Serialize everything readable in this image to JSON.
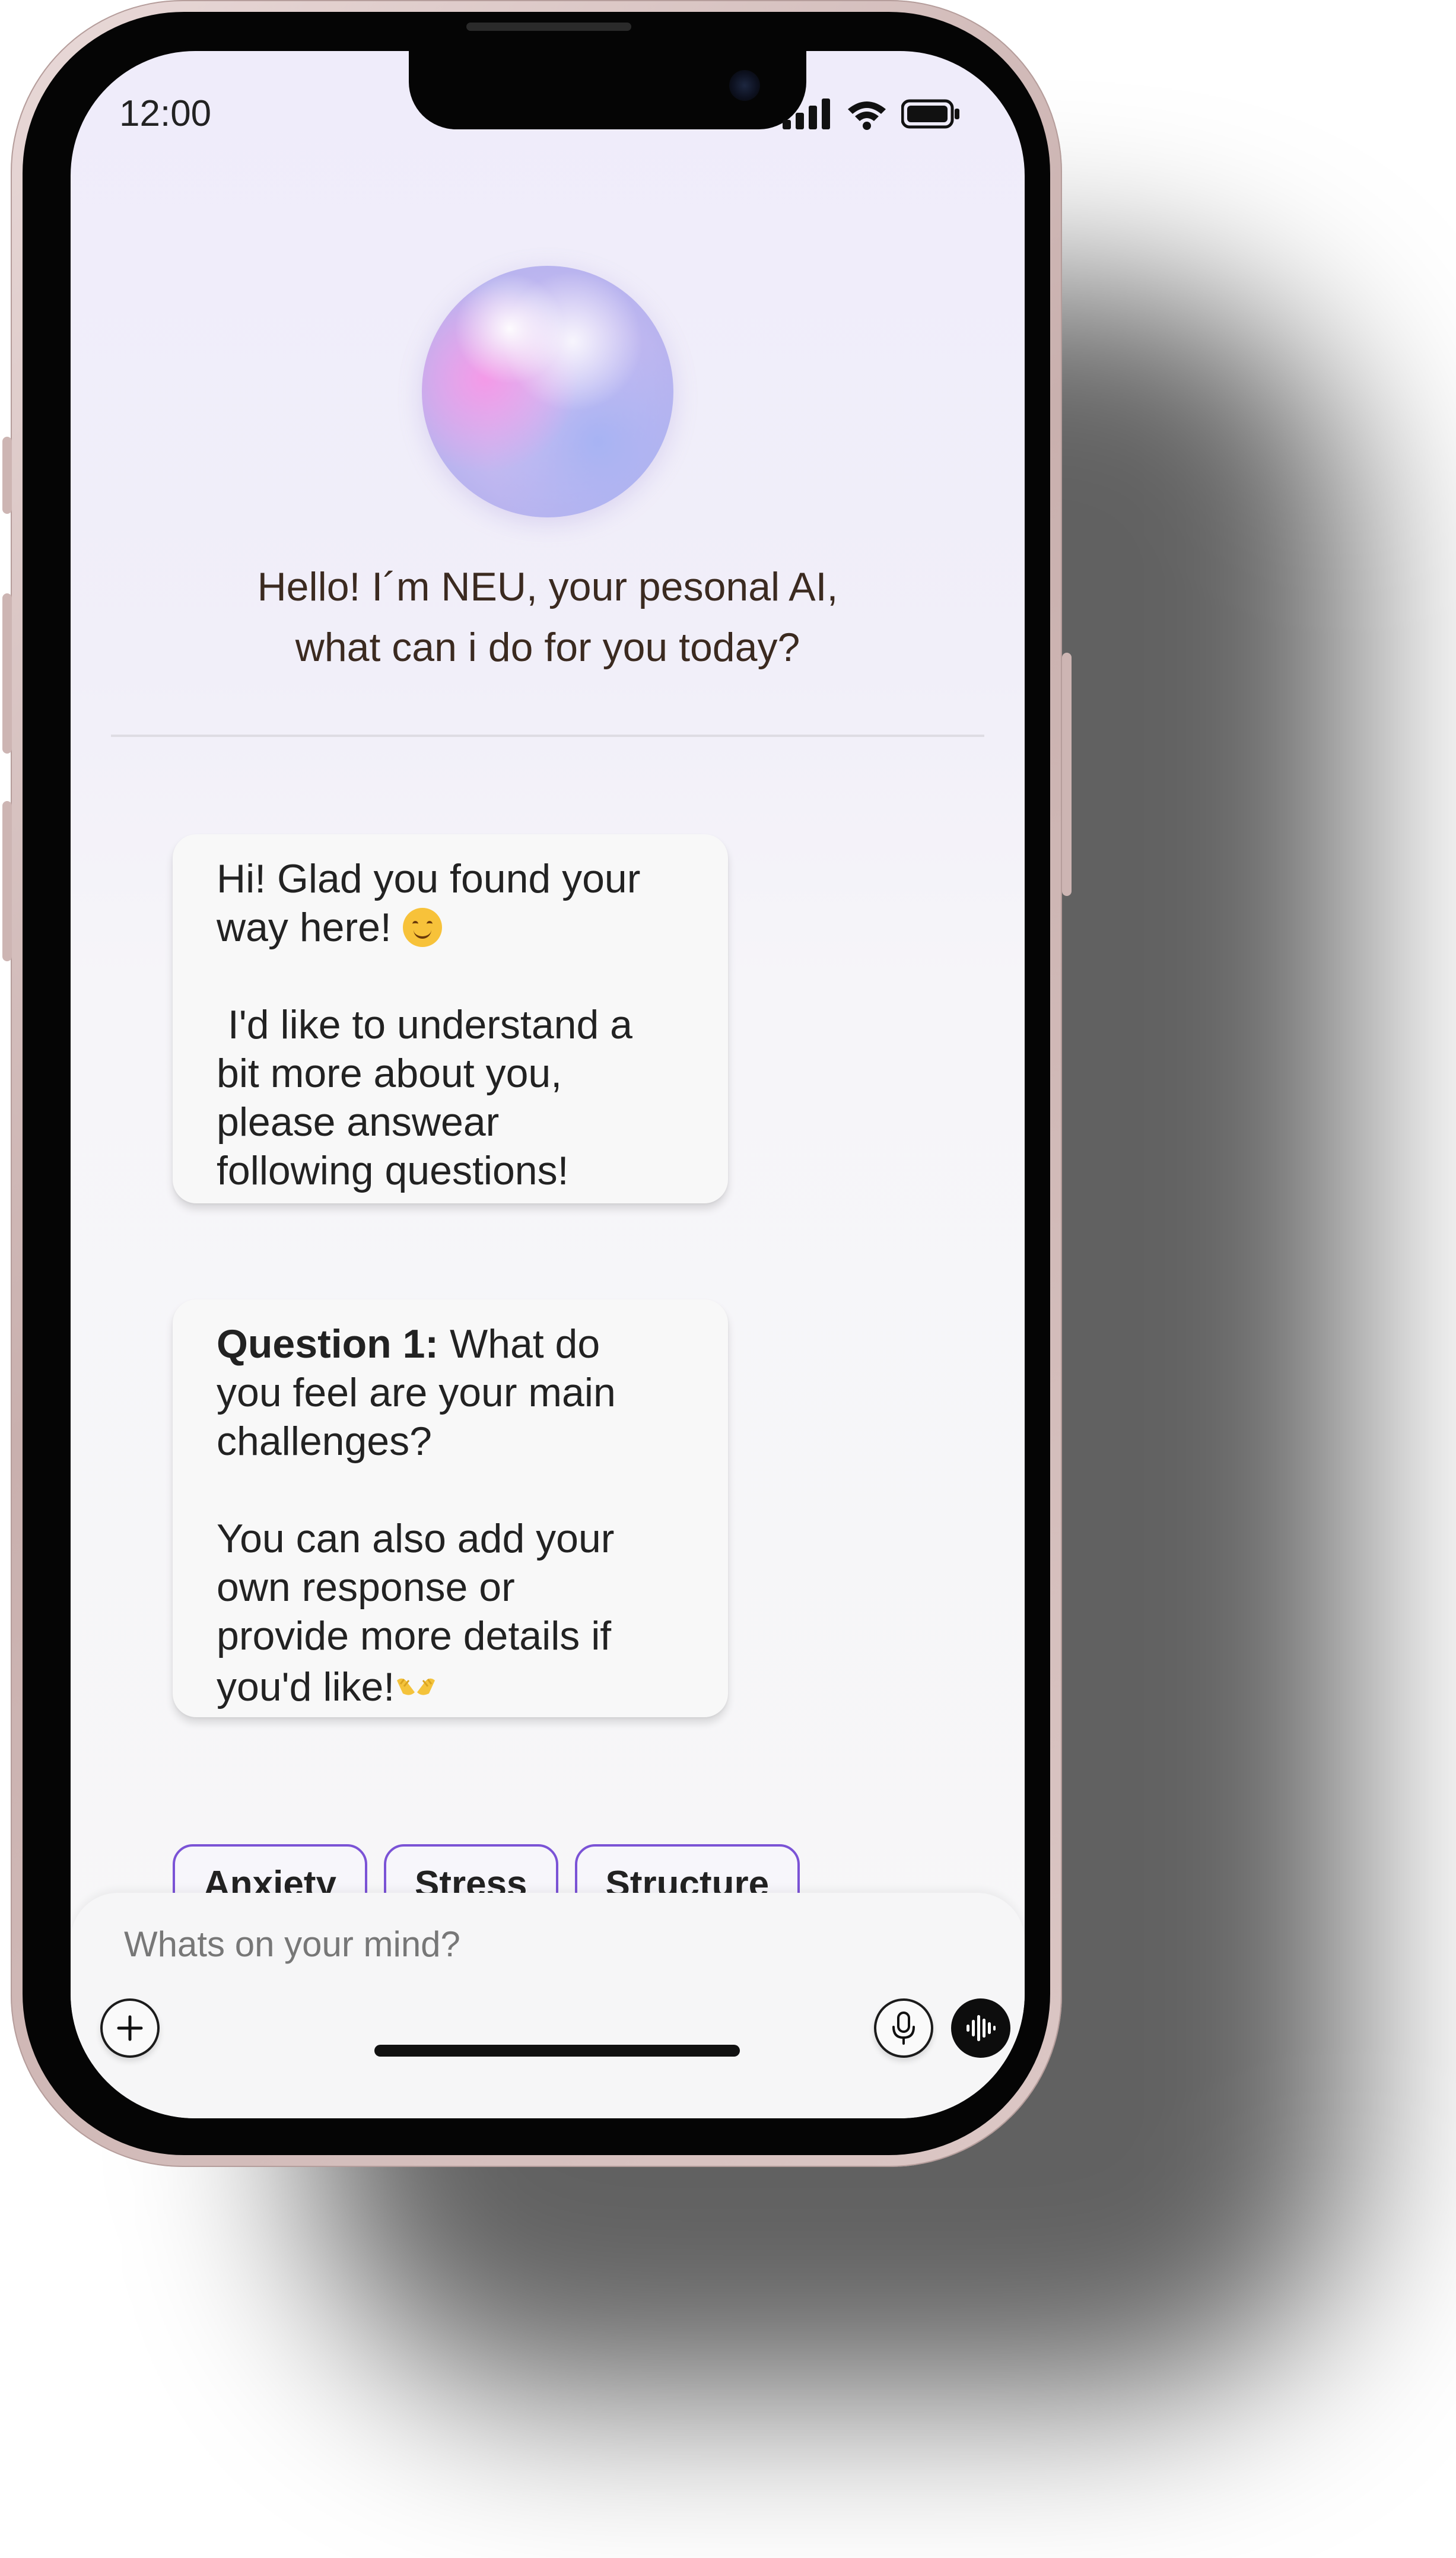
{
  "status_bar": {
    "time": "12:00",
    "icons": [
      "cellular-signal-icon",
      "wifi-icon",
      "battery-icon"
    ]
  },
  "assistant": {
    "greeting_line1": "Hello! I´m NEU, your pesonal AI,",
    "greeting_line2": "what can i do for you today?"
  },
  "messages": [
    {
      "line1": "Hi! Glad you found your",
      "line2": "way here! ",
      "line3": " I'd like to understand a",
      "line4": "bit more about you,",
      "line5": "please answear",
      "line6": "following questions!"
    },
    {
      "bold": "Question 1:",
      "line1_rest": " What do",
      "line2": "you feel are your main",
      "line3": "challenges?",
      "line4": "You can also add your",
      "line5": "own response or",
      "line6": "provide more details if",
      "line7": "you'd like!"
    }
  ],
  "chips": [
    "Anxiety",
    "Stress",
    "Structure"
  ],
  "composer": {
    "placeholder": "Whats on your mind?"
  },
  "colors": {
    "chip_border": "#7b53d6",
    "voice_button": "#0d0d0d"
  }
}
